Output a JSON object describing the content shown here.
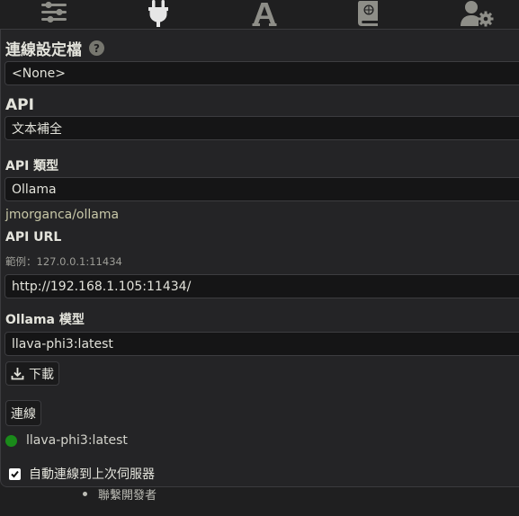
{
  "tabs": [
    {
      "icon": "sliders-icon"
    },
    {
      "icon": "plug-icon"
    },
    {
      "icon": "font-icon"
    },
    {
      "icon": "book-atlas-icon"
    },
    {
      "icon": "user-gear-icon"
    }
  ],
  "connection_profile": {
    "title": "連線設定檔",
    "help": "?",
    "selected": "<None>"
  },
  "api": {
    "title": "API",
    "selected": "文本補全"
  },
  "api_type": {
    "label": "API 類型",
    "selected": "Ollama",
    "link": "jmorganca/ollama"
  },
  "api_url": {
    "label": "API URL",
    "hint": "範例：127.0.0.1:11434",
    "value": "http://192.168.1.105:11434/"
  },
  "model": {
    "label": "Ollama 模型",
    "selected": "llava-phi3:latest",
    "download_label": "下載"
  },
  "connect": {
    "button_label": "連線",
    "status_text": "llava-phi3:latest",
    "status_color": "#1a8a1a"
  },
  "auto_connect": {
    "label": "自動連線到上次伺服器",
    "checked": true
  },
  "background_list": {
    "item": "聯繫開發者"
  },
  "colors": {
    "background": "#1f1f20",
    "panel": "#242426",
    "input": "#151516",
    "icon": "#8e8e88",
    "icon_active": "#e6e6e6"
  }
}
